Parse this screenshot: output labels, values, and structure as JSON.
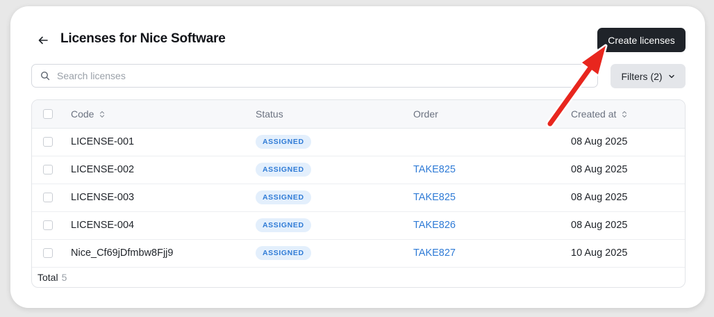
{
  "header": {
    "title": "Licenses for Nice Software",
    "create_label": "Create licenses"
  },
  "search": {
    "placeholder": "Search licenses"
  },
  "filters": {
    "label": "Filters (2)"
  },
  "table": {
    "columns": {
      "code": "Code",
      "status": "Status",
      "order": "Order",
      "created": "Created at"
    },
    "rows": [
      {
        "code": "LICENSE-001",
        "status": "ASSIGNED",
        "order": "",
        "created": "08 Aug 2025"
      },
      {
        "code": "LICENSE-002",
        "status": "ASSIGNED",
        "order": "TAKE825",
        "created": "08 Aug 2025"
      },
      {
        "code": "LICENSE-003",
        "status": "ASSIGNED",
        "order": "TAKE825",
        "created": "08 Aug 2025"
      },
      {
        "code": "LICENSE-004",
        "status": "ASSIGNED",
        "order": "TAKE826",
        "created": "08 Aug 2025"
      },
      {
        "code": "Nice_Cf69jDfmbw8Fjj9",
        "status": "ASSIGNED",
        "order": "TAKE827",
        "created": "10 Aug 2025"
      }
    ],
    "total_label": "Total",
    "total_count": "5"
  },
  "colors": {
    "primary_button": "#1f2329",
    "badge_bg": "#e3effc",
    "link": "#2f7bd6",
    "annotation_arrow": "#e8261e"
  },
  "icons": {
    "back": "arrow-left-icon",
    "search": "search-icon",
    "filters": "chevron-down-icon",
    "sort": "sort-icon"
  }
}
